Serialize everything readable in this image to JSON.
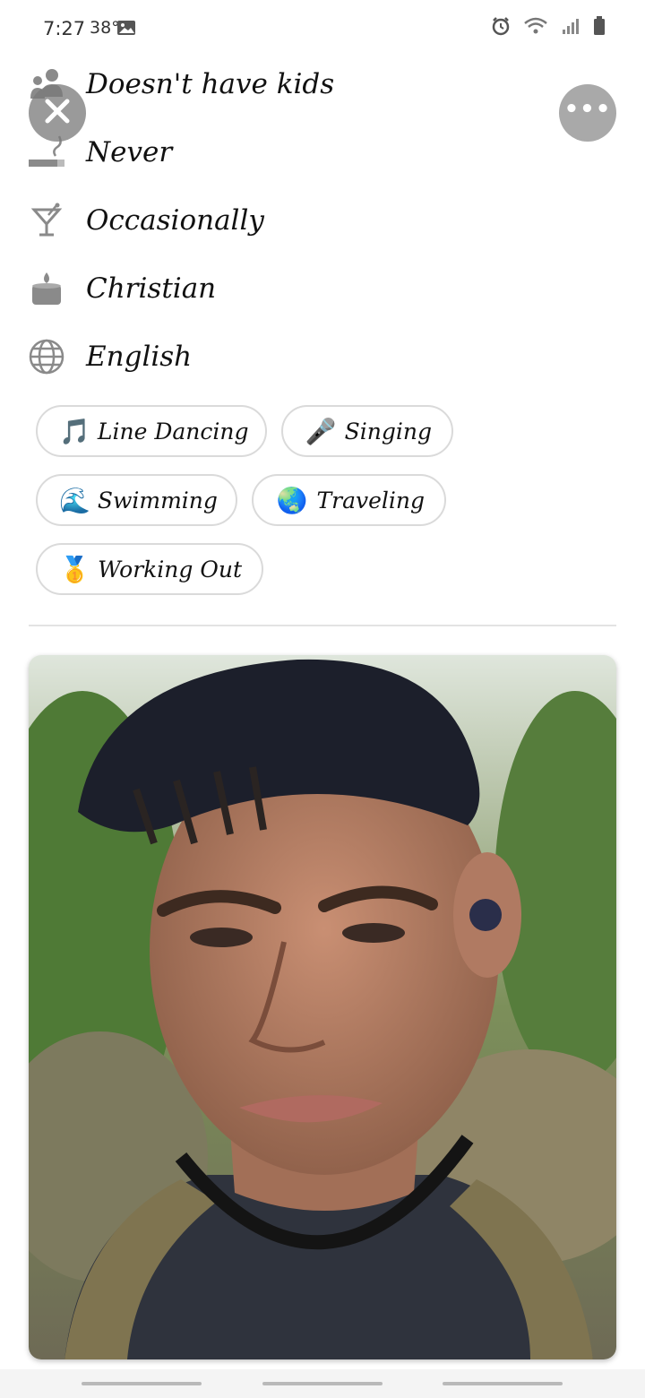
{
  "status": {
    "time": "7:27",
    "temperature": "38°",
    "icons": [
      "gallery-icon",
      "alarm-icon",
      "wifi-icon",
      "signal-icon",
      "battery-icon"
    ]
  },
  "header": {
    "close_icon": "close-icon",
    "more_icon": "more-icon",
    "more_dots": "•••"
  },
  "details": [
    {
      "icon": "kids-icon",
      "text": "Doesn't have kids"
    },
    {
      "icon": "smoking-icon",
      "text": "Never"
    },
    {
      "icon": "cocktail-icon",
      "text": "Occasionally"
    },
    {
      "icon": "candle-icon",
      "text": "Christian"
    },
    {
      "icon": "globe-icon",
      "text": "English"
    }
  ],
  "interests": [
    {
      "emoji": "🎵",
      "label": "Line Dancing"
    },
    {
      "emoji": "🎤",
      "label": "Singing"
    },
    {
      "emoji": "🌊",
      "label": "Swimming"
    },
    {
      "emoji": "🌏",
      "label": "Traveling"
    },
    {
      "emoji": "🥇",
      "label": "Working Out"
    }
  ],
  "colors": {
    "button_overlay": "#8c8c8c",
    "chip_border": "#dadada",
    "icon_gray": "#8a8a8a"
  }
}
